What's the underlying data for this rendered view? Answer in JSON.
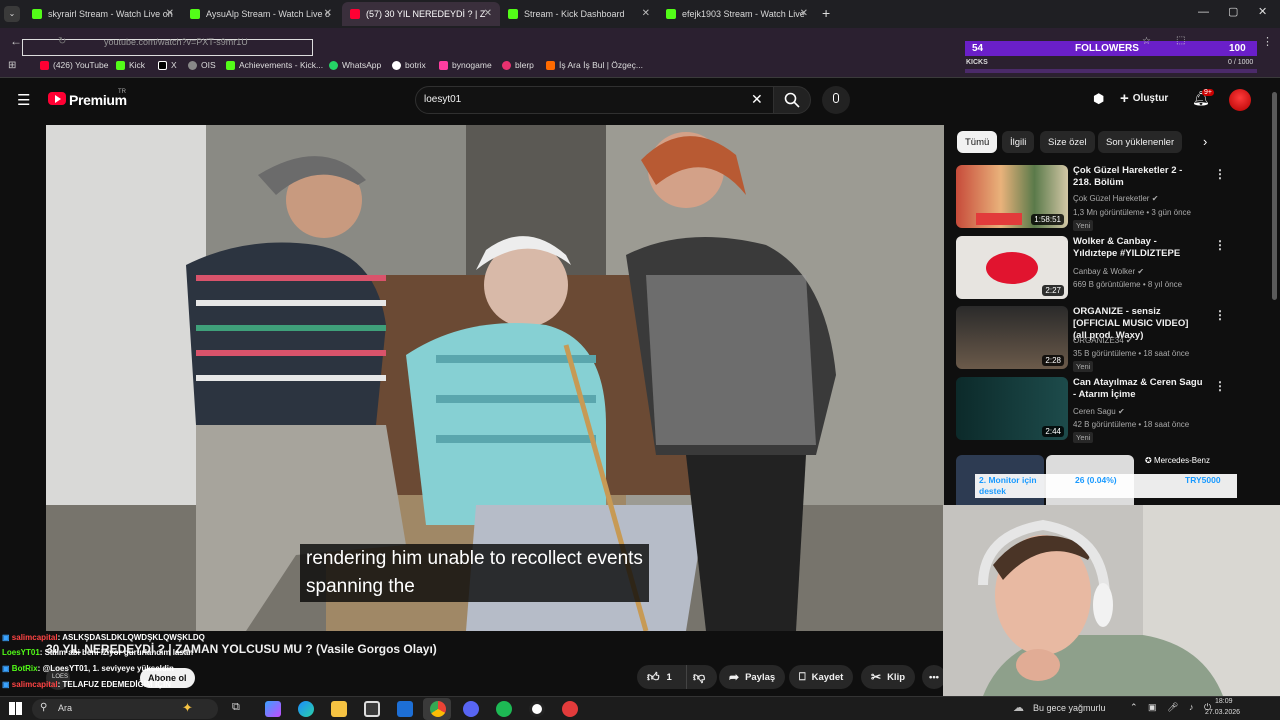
{
  "tabs": [
    {
      "label": "skyrairl Stream - Watch Live on",
      "color": "#53fc18"
    },
    {
      "label": "AysuAlp Stream - Watch Live o",
      "color": "#53fc18"
    },
    {
      "label": "(57) 30 YIL NEREDEYDİ ? | Z",
      "color": "#ff0033"
    },
    {
      "label": "Stream - Kick Dashboard",
      "color": "#53fc18"
    },
    {
      "label": "efejk1903 Stream - Watch Live",
      "color": "#53fc18"
    }
  ],
  "address": {
    "url": "youtube.com/watch?v=PXT-s9mr1U"
  },
  "overlay": {
    "kicks_label": "KICKS",
    "kicks_count": "54",
    "followers_label": "FOLLOWERS",
    "followers_count": "100",
    "followers_progress": "0 / 1000"
  },
  "bookmarks": [
    {
      "label": "(426) YouTube",
      "color": "#ff0033"
    },
    {
      "label": "Kick",
      "color": "#53fc18"
    },
    {
      "label": "X",
      "color": "#ffffff"
    },
    {
      "label": "OIS",
      "color": "#aaaaaa"
    },
    {
      "label": "Achievements - Kick...",
      "color": "#53fc18"
    },
    {
      "label": "WhatsApp",
      "color": "#25d366"
    },
    {
      "label": "botrix",
      "color": "#ffffff"
    },
    {
      "label": "bynogame",
      "color": "#ff3da0"
    },
    {
      "label": "blerp",
      "color": "#e8316f"
    },
    {
      "label": "İş Ara İş Bul | Özgeç...",
      "color": "#ff6a00"
    }
  ],
  "youtube": {
    "logo": "Premium",
    "logo_sup": "TR",
    "search_value": "loesyt01",
    "create_label": "Oluştur",
    "notif_badge": "9+",
    "subtitle_line1": "rendering him unable to recollect events",
    "subtitle_line2": "spanning the",
    "video_title": "30 YIL NEREDEYDİ ? | ZAMAN YOLCUSU MU ? (Vasile Gorgos Olayı)",
    "like_count": "1",
    "share_label": "Paylaş",
    "save_label": "Kaydet",
    "clip_label": "Klip",
    "subscribe_label": "Abone ol",
    "channel_short": "LOES"
  },
  "chips": [
    "Tümü",
    "İlgili",
    "Size özel",
    "Son yüklenenler"
  ],
  "cards": [
    {
      "title": "Çok Güzel Hareketler 2 - 218. Bölüm",
      "channel": "Çok Güzel Hareketler",
      "meta": "1,3 Mn görüntüleme • 3 gün önce",
      "badge": "Yeni",
      "duration": "1:58:51"
    },
    {
      "title": "Wolker & Canbay - Yıldıztepe #YILDIZTEPE",
      "channel": "Canbay & Wolker",
      "meta": "669 B görüntüleme • 8 yıl önce",
      "badge": "",
      "duration": "2:27"
    },
    {
      "title": "ORGANIZE - sensiz [OFFICIAL MUSIC VIDEO] (all prod. Waxy)",
      "channel": "ORGANIZE34",
      "meta": "35 B görüntüleme • 18 saat önce",
      "badge": "Yeni",
      "duration": "2:28"
    },
    {
      "title": "Can Atayılmaz & Ceren Sagu - Atarım İçime",
      "channel": "Ceren Sagu",
      "meta": "42 B görüntüleme • 18 saat önce",
      "badge": "Yeni",
      "duration": "2:44"
    }
  ],
  "donation": {
    "goal": "2. Monitor için destek",
    "progress": "26 (0.04%)",
    "target": "TRY5000",
    "sponsor": "Mercedes-Benz"
  },
  "chat": [
    {
      "user": "salimcapital",
      "text": ": ASLKŞDASLDKLQWDŞKLQWŞKLDQ",
      "color": "#ff4444"
    },
    {
      "user": "LoesYT01",
      "text": ": Salim abi beni iziyor gururlandım lasan",
      "color": "#53fc18"
    },
    {
      "user": "BotRix",
      "text": ": @LoesYT01, 1. seviyeye yükseldin",
      "color": "#53fc18"
    },
    {
      "user": "salimcapital",
      "text": ": TELAFUZ EDEMEDİĞİM İÇİN",
      "color": "#ff4444"
    }
  ],
  "taskbar": {
    "search": "Ara",
    "weather": "Bu gece yağmurlu",
    "time": "18:09",
    "date": "27.03.2026"
  }
}
